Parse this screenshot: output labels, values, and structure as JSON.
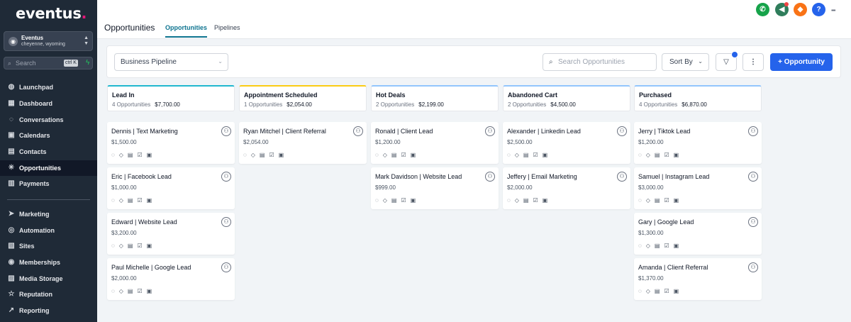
{
  "sidebar": {
    "logo": "eventus",
    "account": {
      "name": "Eventus",
      "location": "cheyenne, wyoming"
    },
    "search": {
      "placeholder": "Search",
      "shortcut": "ctrl K"
    },
    "items": [
      {
        "label": "Launchpad",
        "icon": "rocket-icon",
        "glyph": "◍"
      },
      {
        "label": "Dashboard",
        "icon": "dashboard-icon",
        "glyph": "▦"
      },
      {
        "label": "Conversations",
        "icon": "chat-icon",
        "glyph": "◌"
      },
      {
        "label": "Calendars",
        "icon": "calendar-icon",
        "glyph": "▣"
      },
      {
        "label": "Contacts",
        "icon": "contacts-icon",
        "glyph": "▤"
      },
      {
        "label": "Opportunities",
        "icon": "opportunities-icon",
        "glyph": "✳"
      },
      {
        "label": "Payments",
        "icon": "payments-icon",
        "glyph": "▥"
      },
      {
        "label": "Marketing",
        "icon": "send-icon",
        "glyph": "➤"
      },
      {
        "label": "Automation",
        "icon": "automation-icon",
        "glyph": "◎"
      },
      {
        "label": "Sites",
        "icon": "sites-icon",
        "glyph": "▧"
      },
      {
        "label": "Memberships",
        "icon": "memberships-icon",
        "glyph": "◉"
      },
      {
        "label": "Media Storage",
        "icon": "media-icon",
        "glyph": "▨"
      },
      {
        "label": "Reputation",
        "icon": "star-icon",
        "glyph": "☆"
      },
      {
        "label": "Reporting",
        "icon": "chart-icon",
        "glyph": "↗"
      }
    ]
  },
  "header": {
    "title": "Opportunities",
    "tabs": [
      "Opportunities",
      "Pipelines"
    ]
  },
  "top_icons": {
    "phone": "✆",
    "megaphone": "◀",
    "bell": "◆",
    "help": "?",
    "avatar": "▪▪▪"
  },
  "toolbar": {
    "pipeline": "Business Pipeline",
    "search_placeholder": "Search Opportunities",
    "sort_label": "Sort By",
    "add_label": "+ Opportunity"
  },
  "colors": {
    "accent": "#2563eb",
    "tab_active": "#0e7490",
    "lead_in": "#22b8cf",
    "appointment": "#facc15",
    "hot_deals": "#93c5fd",
    "abandoned": "#93c5fd",
    "purchased": "#93c5fd"
  },
  "columns": [
    {
      "title": "Lead In",
      "count": "4 Opportunities",
      "total": "$7,700.00",
      "cards": [
        {
          "name": "Dennis | Text Marketing",
          "value": "$1,500.00"
        },
        {
          "name": "Eric | Facebook Lead",
          "value": "$1,000.00"
        },
        {
          "name": "Edward | Website Lead",
          "value": "$3,200.00"
        },
        {
          "name": "Paul Michelle | Google Lead",
          "value": "$2,000.00"
        }
      ]
    },
    {
      "title": "Appointment Scheduled",
      "count": "1 Opportunities",
      "total": "$2,054.00",
      "cards": [
        {
          "name": "Ryan Mitchel | Client Referral",
          "value": "$2,054.00"
        }
      ]
    },
    {
      "title": "Hot Deals",
      "count": "2 Opportunities",
      "total": "$2,199.00",
      "cards": [
        {
          "name": "Ronald | Client Lead",
          "value": "$1,200.00"
        },
        {
          "name": "Mark Davidson | Website Lead",
          "value": "$999.00"
        }
      ]
    },
    {
      "title": "Abandoned Cart",
      "count": "2 Opportunities",
      "total": "$4,500.00",
      "cards": [
        {
          "name": "Alexander | Linkedin Lead",
          "value": "$2,500.00"
        },
        {
          "name": "Jeffery | Email Marketing",
          "value": "$2,000.00"
        }
      ]
    },
    {
      "title": "Purchased",
      "count": "4 Opportunities",
      "total": "$6,870.00",
      "cards": [
        {
          "name": "Jerry | Tiktok Lead",
          "value": "$1,200.00"
        },
        {
          "name": "Samuel | Instagram Lead",
          "value": "$3,000.00"
        },
        {
          "name": "Gary | Google Lead",
          "value": "$1,300.00"
        },
        {
          "name": "Amanda | Client Referral",
          "value": "$1,370.00"
        }
      ]
    }
  ],
  "card_icons": "◌◇▤☑▣"
}
